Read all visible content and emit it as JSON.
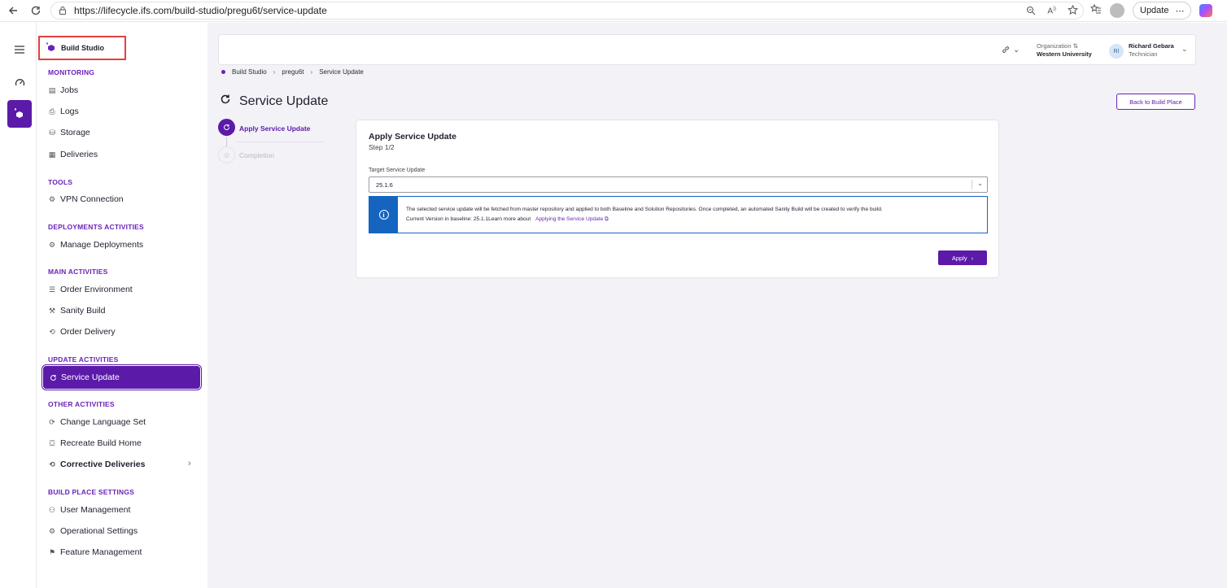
{
  "browser": {
    "url": "https://lifecycle.ifs.com/build-studio/pregu6t/service-update",
    "update_label": "Update",
    "more_label": "⋯"
  },
  "sidebar": {
    "brand": "Build Studio",
    "sections": {
      "monitoring": "MONITORING",
      "tools": "TOOLS",
      "deployments": "DEPLOYMENTS ACTIVITIES",
      "main": "MAIN ACTIVITIES",
      "update": "UPDATE ACTIVITIES",
      "other": "OTHER ACTIVITIES",
      "settings": "BUILD PLACE SETTINGS"
    },
    "items": {
      "jobs": "Jobs",
      "logs": "Logs",
      "storage": "Storage",
      "deliveries": "Deliveries",
      "vpn": "VPN Connection",
      "manage_deployments": "Manage Deployments",
      "order_environment": "Order Environment",
      "sanity_build": "Sanity Build",
      "order_delivery": "Order Delivery",
      "service_update": "Service Update",
      "change_language": "Change Language Set",
      "recreate_build_home": "Recreate Build Home",
      "corrective_deliveries": "Corrective Deliveries",
      "user_management": "User Management",
      "operational_settings": "Operational Settings",
      "feature_management": "Feature Management"
    }
  },
  "header": {
    "org_label": "Organization",
    "org_value": "Western University",
    "user_initials": "RI",
    "user_name": "Richard Gebara",
    "user_role": "Technician"
  },
  "breadcrumb": [
    "Build Studio",
    "pregu6t",
    "Service Update"
  ],
  "page": {
    "title": "Service Update",
    "back_button": "Back to Build Place"
  },
  "stepper": {
    "step1": "Apply Service Update",
    "step2": "Completion"
  },
  "card": {
    "title": "Apply Service Update",
    "step": "Step 1/2",
    "field_label": "Target Service Update",
    "selected_value": "25.1.6",
    "info_line1": "The selected service update will be fetched from master repository and applied to both Baseline and Solution Repositories. Once completed, an automated Sanity Build will be created to verify the build.",
    "info_line2": "Current Version in baseline: 25.1.1Learn more about",
    "info_link": "Applying the Service Update",
    "apply_button": "Apply"
  },
  "colors": {
    "accent": "#5b1aa8",
    "info": "#1565c0",
    "highlight_box": "#e0403f"
  }
}
